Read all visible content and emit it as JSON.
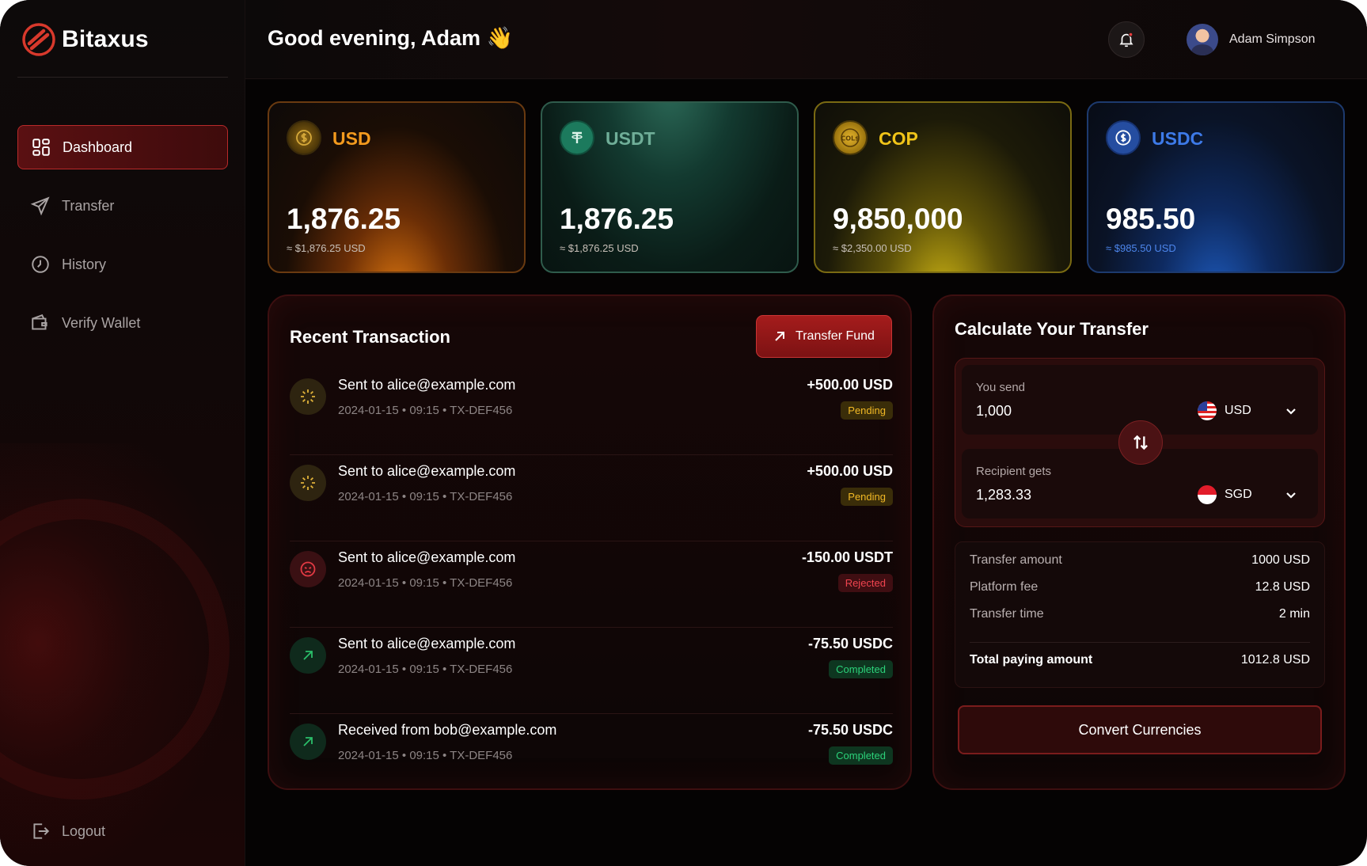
{
  "app": {
    "name": "Bitaxus"
  },
  "sidebar": {
    "items": [
      {
        "label": "Dashboard",
        "icon": "dashboard-icon",
        "active": true
      },
      {
        "label": "Transfer",
        "icon": "send-icon",
        "active": false
      },
      {
        "label": "History",
        "icon": "clock-icon",
        "active": false
      },
      {
        "label": "Verify Wallet",
        "icon": "wallet-icon",
        "active": false
      }
    ],
    "logout_label": "Logout"
  },
  "header": {
    "greeting": "Good evening, Adam 👋",
    "user_name": "Adam Simpson"
  },
  "balances": [
    {
      "currency": "USD",
      "amount": "1,876.25",
      "equivalent": "≈ $1,876.25 USD",
      "color": "#f39a1e"
    },
    {
      "currency": "USDT",
      "amount": "1,876.25",
      "equivalent": "≈ $1,876.25 USD",
      "color": "#6fae98"
    },
    {
      "currency": "COP",
      "amount": "9,850,000",
      "equivalent": "≈ $2,350.00 USD",
      "color": "#f0c419"
    },
    {
      "currency": "USDC",
      "amount": "985.50",
      "equivalent": "≈ $985.50 USD",
      "color": "#3d7ae8"
    }
  ],
  "transactions": {
    "title": "Recent Transaction",
    "button_label": "Transfer Fund",
    "rows": [
      {
        "title": "Sent to alice@example.com",
        "meta": "2024-01-15 • 09:15 • TX-DEF456",
        "amount": "+500.00 USD",
        "status": "Pending",
        "icon": "loader-icon"
      },
      {
        "title": "Sent to alice@example.com",
        "meta": "2024-01-15 • 09:15 • TX-DEF456",
        "amount": "+500.00 USD",
        "status": "Pending",
        "icon": "loader-icon"
      },
      {
        "title": "Sent to alice@example.com",
        "meta": "2024-01-15 • 09:15 • TX-DEF456",
        "amount": "-150.00 USDT",
        "status": "Rejected",
        "icon": "sad-face-icon"
      },
      {
        "title": "Sent to alice@example.com",
        "meta": "2024-01-15 • 09:15 • TX-DEF456",
        "amount": "-75.50 USDC",
        "status": "Completed",
        "icon": "arrow-up-right-icon"
      },
      {
        "title": "Received from bob@example.com",
        "meta": "2024-01-15 • 09:15 • TX-DEF456",
        "amount": "-75.50 USDC",
        "status": "Completed",
        "icon": "arrow-up-right-icon"
      }
    ]
  },
  "calculator": {
    "title": "Calculate Your Transfer",
    "send_label": "You send",
    "send_value": "1,000",
    "send_currency": "USD",
    "receive_label": "Recipient gets",
    "receive_value": "1,283.33",
    "receive_currency": "SGD",
    "summary": {
      "transfer_amount_label": "Transfer amount",
      "transfer_amount": "1000 USD",
      "platform_fee_label": "Platform fee",
      "platform_fee": "12.8 USD",
      "transfer_time_label": "Transfer time",
      "transfer_time": "2 min",
      "total_label": "Total paying amount",
      "total": "1012.8 USD"
    },
    "convert_label": "Convert Currencies"
  }
}
